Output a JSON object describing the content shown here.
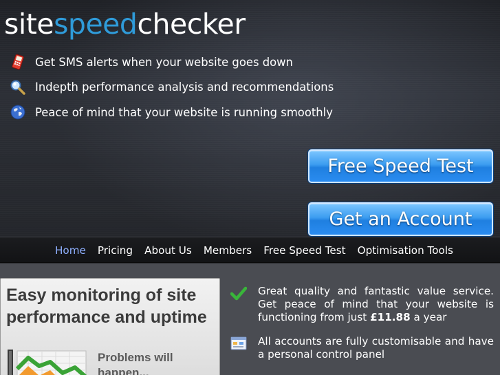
{
  "logo": {
    "part1": "site",
    "part2": "speed",
    "part3": "checker"
  },
  "features": [
    {
      "icon": "phone-icon",
      "text": "Get SMS alerts when your website goes down"
    },
    {
      "icon": "magnifier-icon",
      "text": "Indepth performance analysis and recommendations"
    },
    {
      "icon": "globe-icon",
      "text": "Peace of mind that your website is running smoothly"
    }
  ],
  "cta": {
    "speed_test": "Free Speed Test",
    "account": "Get an Account"
  },
  "nav": {
    "items": [
      "Home",
      "Pricing",
      "About Us",
      "Members",
      "Free Speed Test",
      "Optimisation Tools"
    ],
    "active": "Home"
  },
  "promo": {
    "title": "Easy monitoring of site performance and uptime",
    "sub": "Problems will happen..."
  },
  "bullets": [
    {
      "icon": "checkmark-icon",
      "text_before": "Great quality and fantastic value service. Get peace of mind that your website is functioning from just ",
      "price": "£11.88",
      "text_after": " a year"
    },
    {
      "icon": "control-panel-icon",
      "text": "All accounts are fully customisable and have a personal control panel"
    }
  ],
  "colors": {
    "brand_blue": "#2f9bd9",
    "nav_active": "#8fb0ff",
    "button_blue": "#2a8cf0"
  }
}
